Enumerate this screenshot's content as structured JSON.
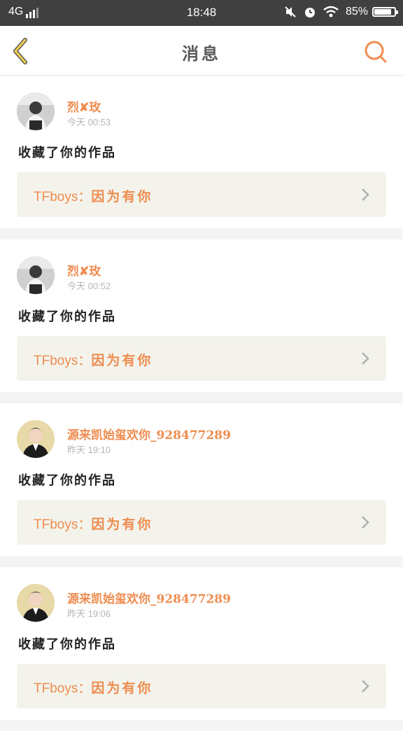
{
  "status_bar": {
    "network": "4G",
    "time": "18:48",
    "battery": "85%",
    "battery_level": 0.85,
    "icons": [
      "signal-icon",
      "mute-icon",
      "alarm-icon",
      "wifi-icon",
      "battery-icon"
    ]
  },
  "header": {
    "title": "消息",
    "back_icon": "back-icon",
    "search_icon": "search-icon"
  },
  "colors": {
    "accent": "#ef8c4f",
    "back_chevron": "#f0d050",
    "card_bg": "#f3f3ec",
    "divider": "#f4f4f4"
  },
  "messages": [
    {
      "username": "烈✘玫",
      "time": "今天 00:53",
      "action": "收藏了你的作品",
      "work_prefix": "TFboys：",
      "work_title": "因为有你"
    },
    {
      "username": "烈✘玫",
      "time": "今天 00:52",
      "action": "收藏了你的作品",
      "work_prefix": "TFboys：",
      "work_title": "因为有你"
    },
    {
      "username": "源来凯始玺欢你_928477289",
      "time": "昨天 19:10",
      "action": "收藏了你的作品",
      "work_prefix": "TFboys：",
      "work_title": "因为有你"
    },
    {
      "username": "源来凯始玺欢你_928477289",
      "time": "昨天 19:06",
      "action": "收藏了你的作品",
      "work_prefix": "TFboys：",
      "work_title": "因为有你"
    }
  ]
}
